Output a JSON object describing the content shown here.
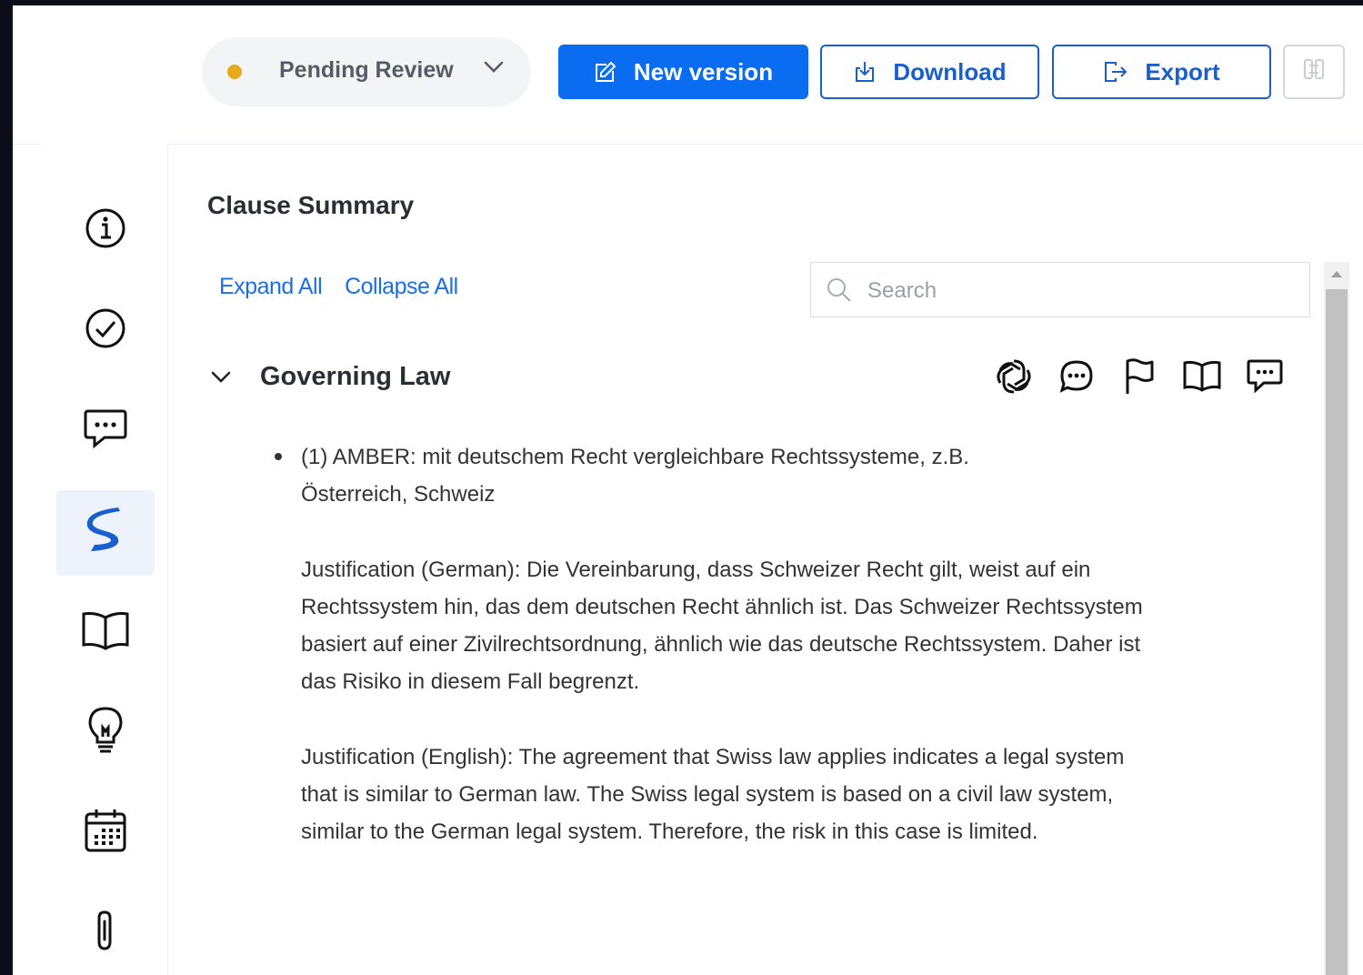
{
  "header": {
    "status": {
      "label": "Pending Review",
      "dot_color": "#e8a91a",
      "icon": "chevron-down-icon"
    },
    "buttons": {
      "new_version": {
        "label": "New version",
        "icon": "edit-icon"
      },
      "download": {
        "label": "Download",
        "icon": "download-icon"
      },
      "export": {
        "label": "Export",
        "icon": "export-icon"
      },
      "sync": {
        "icon": "sync-icon"
      }
    }
  },
  "sidebar": {
    "items": [
      {
        "icon": "info-icon"
      },
      {
        "icon": "check-circle-icon"
      },
      {
        "icon": "comment-icon"
      },
      {
        "icon": "brand-s-icon",
        "active": true
      },
      {
        "icon": "book-icon"
      },
      {
        "icon": "lightbulb-icon"
      },
      {
        "icon": "calendar-icon"
      },
      {
        "icon": "paperclip-icon"
      }
    ]
  },
  "main": {
    "title": "Clause Summary",
    "expand_all": "Expand All",
    "collapse_all": "Collapse All",
    "search": {
      "placeholder": "Search",
      "value": ""
    },
    "section": {
      "title": "Governing Law",
      "actions": [
        "ai-icon",
        "chat-icon",
        "flag-icon",
        "book-icon",
        "comment-icon"
      ],
      "item": {
        "heading_line1": "(1) AMBER: mit deutschem Recht vergleichbare Rechtssysteme, z.B.",
        "heading_line2": "Österreich, Schweiz",
        "justification_de": "Justification (German): Die Vereinbarung, dass Schweizer Recht gilt, weist auf ein Rechtssystem hin, das dem deutschen Recht ähnlich ist. Das Schweizer Rechtssystem basiert auf einer Zivilrechtsordnung, ähnlich wie das deutsche Rechtssystem. Daher ist das Risiko in diesem Fall begrenzt.",
        "justification_en": "Justification (English): The agreement that Swiss law applies indicates a legal system that is similar to German law. The Swiss legal system is based on a civil law system, similar to the German legal system. Therefore, the risk in this case is limited."
      }
    }
  },
  "colors": {
    "primary": "#0a6cf0",
    "accent_outline": "#1a5fd0",
    "link": "#1a6ee8",
    "status_dot": "#e8a91a"
  }
}
